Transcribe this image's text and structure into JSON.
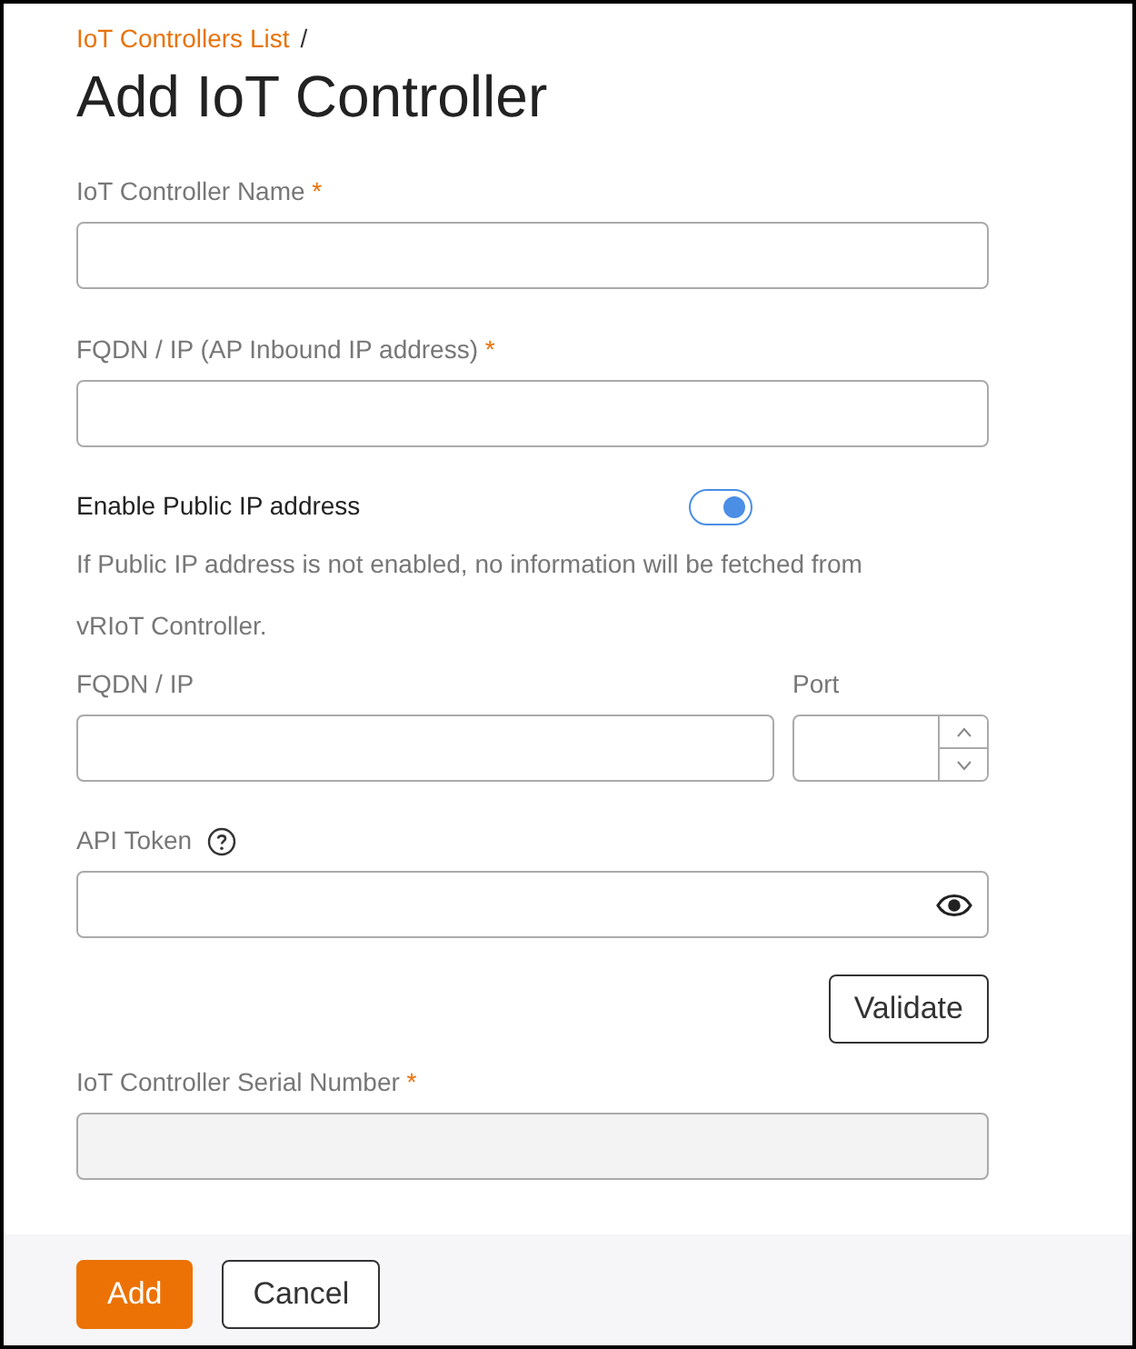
{
  "breadcrumb": {
    "link": "IoT Controllers List",
    "separator": "/"
  },
  "title": "Add IoT Controller",
  "form": [
    {
      "kind": "text",
      "label": "IoT Controller Name",
      "required_mark": "*",
      "disabled": false
    },
    {
      "kind": "text",
      "label": "FQDN / IP (AP Inbound IP address)",
      "required_mark": "*",
      "disabled": false
    },
    {
      "kind": "toggle",
      "label": "Enable Public IP address",
      "on": true
    },
    {
      "kind": "note",
      "text": "If Public IP address is not enabled, no information will be fetched from vRIoT Controller."
    },
    {
      "kind": "pair",
      "fields": [
        {
          "kind": "text",
          "label": "FQDN / IP"
        },
        {
          "kind": "number",
          "label": "Port"
        }
      ]
    },
    {
      "kind": "password",
      "label": "API Token",
      "help_icon": true
    },
    {
      "kind": "button",
      "label": "Validate"
    },
    {
      "kind": "text",
      "label": "IoT Controller Serial Number",
      "required_mark": "*",
      "disabled": true
    }
  ],
  "footer": [
    {
      "label": "Add",
      "primary": true
    },
    {
      "label": "Cancel",
      "primary": false
    }
  ]
}
